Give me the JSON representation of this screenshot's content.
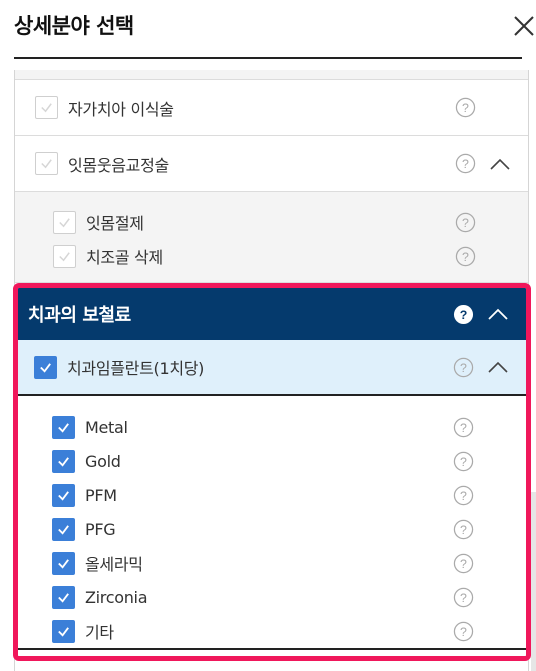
{
  "header": {
    "title": "상세분야 선택"
  },
  "sections": {
    "implant_surgery": {
      "label": "자가치아 이식술",
      "checked": false
    },
    "gum_smile": {
      "label": "잇몸웃음교정술",
      "checked": false,
      "expanded": true,
      "children": [
        {
          "label": "잇몸절제",
          "checked": false
        },
        {
          "label": "치조골 삭제",
          "checked": false
        }
      ]
    },
    "prosthetics": {
      "title": "치과의 보철료",
      "expanded": true,
      "sub": {
        "label": "치과임플란트(1치당)",
        "checked": true,
        "expanded": true
      },
      "items": [
        {
          "label": "Metal",
          "checked": true
        },
        {
          "label": "Gold",
          "checked": true
        },
        {
          "label": "PFM",
          "checked": true
        },
        {
          "label": "PFG",
          "checked": true
        },
        {
          "label": "올세라믹",
          "checked": true
        },
        {
          "label": "Zirconia",
          "checked": true
        },
        {
          "label": "기타",
          "checked": true
        }
      ]
    }
  },
  "colors": {
    "highlight_border": "#f0175b",
    "section_header": "#053a6d",
    "sub_header": "#dff0fb",
    "checkbox_checked": "#3b7fd8"
  }
}
